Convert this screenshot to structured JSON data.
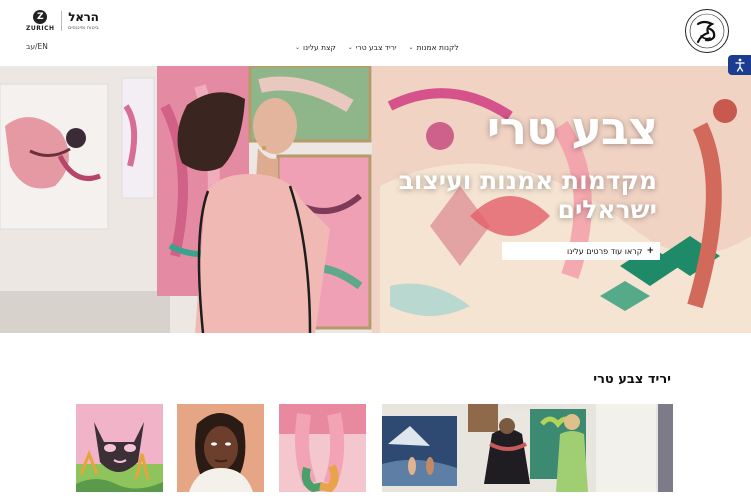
{
  "header": {
    "site_logo_label": "צבע טרי",
    "partners": {
      "harel": {
        "name": "הראל",
        "subtitle": "ביטוח ופיננסים"
      },
      "zurich": {
        "mark": "Z",
        "name": "ZURICH"
      }
    },
    "nav": [
      {
        "label": "קצת עלינו"
      },
      {
        "label": "יריד צבע טרי"
      },
      {
        "label": "לקנות אמנות"
      }
    ],
    "language": "עב/EN"
  },
  "accessibility": {
    "icon": "accessibility-icon"
  },
  "hero": {
    "title": "צבע טרי",
    "subtitle": "מקדמות אמנות ועיצוב ישראלים",
    "cta_label": "קראו עוד פרטים עלינו",
    "cta_icon": "+"
  },
  "fair_section": {
    "title": "יריד צבע טרי",
    "tiles": [
      {
        "name": "cat-painting"
      },
      {
        "name": "portrait-painting"
      },
      {
        "name": "legs-painting"
      },
      {
        "name": "gallery-visitors-photo"
      }
    ]
  },
  "colors": {
    "accessibility_blue": "#1c3d8f",
    "hero_text": "#ffffff"
  }
}
